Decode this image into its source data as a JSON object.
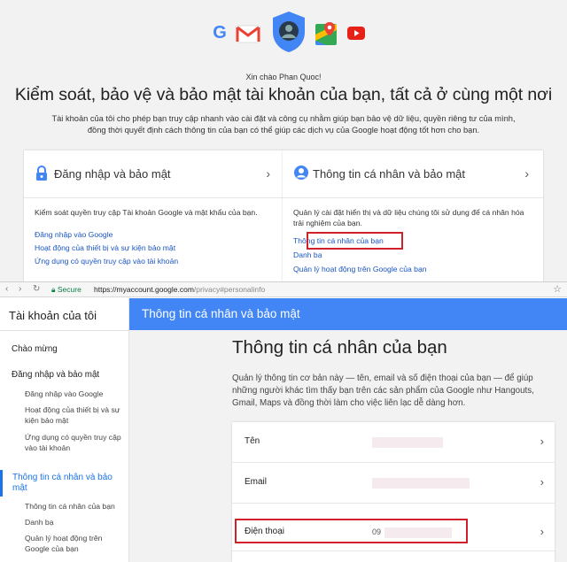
{
  "top": {
    "greeting": "Xin chào Phan Quoc!",
    "headline": "Kiểm soát, bảo vệ và bảo mật tài khoản của bạn, tất cả ở cùng một nơi",
    "lead": "Tài khoản của tôi cho phép bạn truy cập nhanh vào cài đặt và công cụ nhằm giúp bạn bảo vệ dữ liệu, quyền riêng tư của mình, đồng thời quyết định cách thông tin của bạn có thể giúp các dịch vụ của Google hoạt động tốt hơn cho bạn.",
    "app_icons": [
      "google-icon",
      "gmail-icon",
      "account-shield-icon",
      "maps-icon",
      "youtube-icon"
    ],
    "cards": [
      {
        "title": "Đăng nhập và bảo mật",
        "icon": "lock-icon",
        "desc": "Kiểm soát quyền truy cập Tài khoản Google và mật khẩu của bạn.",
        "links": [
          "Đăng nhập vào Google",
          "Hoạt động của thiết bị và sự kiện bảo mật",
          "Ứng dụng có quyền truy cập vào tài khoản"
        ]
      },
      {
        "title": "Thông tin cá nhân và bảo mật",
        "icon": "person-icon",
        "desc": "Quản lý cài đặt hiển thị và dữ liệu chúng tôi sử dụng để cá nhân hóa trải nghiệm của bạn.",
        "links": [
          "Thông tin cá nhân của bạn",
          "Danh bạ",
          "Quản lý hoạt động trên Google của bạn"
        ]
      }
    ]
  },
  "browser": {
    "secure_label": "Secure",
    "url_base": "https://myaccount.google.com",
    "url_path": "/privacy#personalinfo"
  },
  "sidebar": {
    "title": "Tài khoản của tôi",
    "welcome": "Chào mừng",
    "section1": "Đăng nhập và bảo mật",
    "section1_items": [
      "Đăng nhập vào Google",
      "Hoạt động của thiết bị và sự kiện bảo mật",
      "Ứng dụng có quyền truy cập vào tài khoản"
    ],
    "section2": "Thông tin cá nhân và bảo mật",
    "section2_items": [
      "Thông tin cá nhân của bạn",
      "Danh bạ",
      "Quản lý hoạt động trên Google của bạn"
    ]
  },
  "header": {
    "title": "Thông tin cá nhân và bảo mật"
  },
  "main": {
    "title": "Thông tin cá nhân của bạn",
    "desc": "Quản lý thông tin cơ bản này — tên, email và số điện thoại của bạn — để giúp những người khác tìm thấy bạn trên các sản phẩm của Google như Hangouts, Gmail, Maps và đồng thời làm cho việc liên lạc dễ dàng hơn.",
    "rows": [
      {
        "label": "Tên",
        "value": ""
      },
      {
        "label": "Email",
        "value": ""
      },
      {
        "label": "Điện thoại",
        "value": "09"
      }
    ]
  },
  "colors": {
    "accent_blue": "#4285f4",
    "link_blue": "#1a55c2",
    "highlight_red": "#d0202a"
  }
}
